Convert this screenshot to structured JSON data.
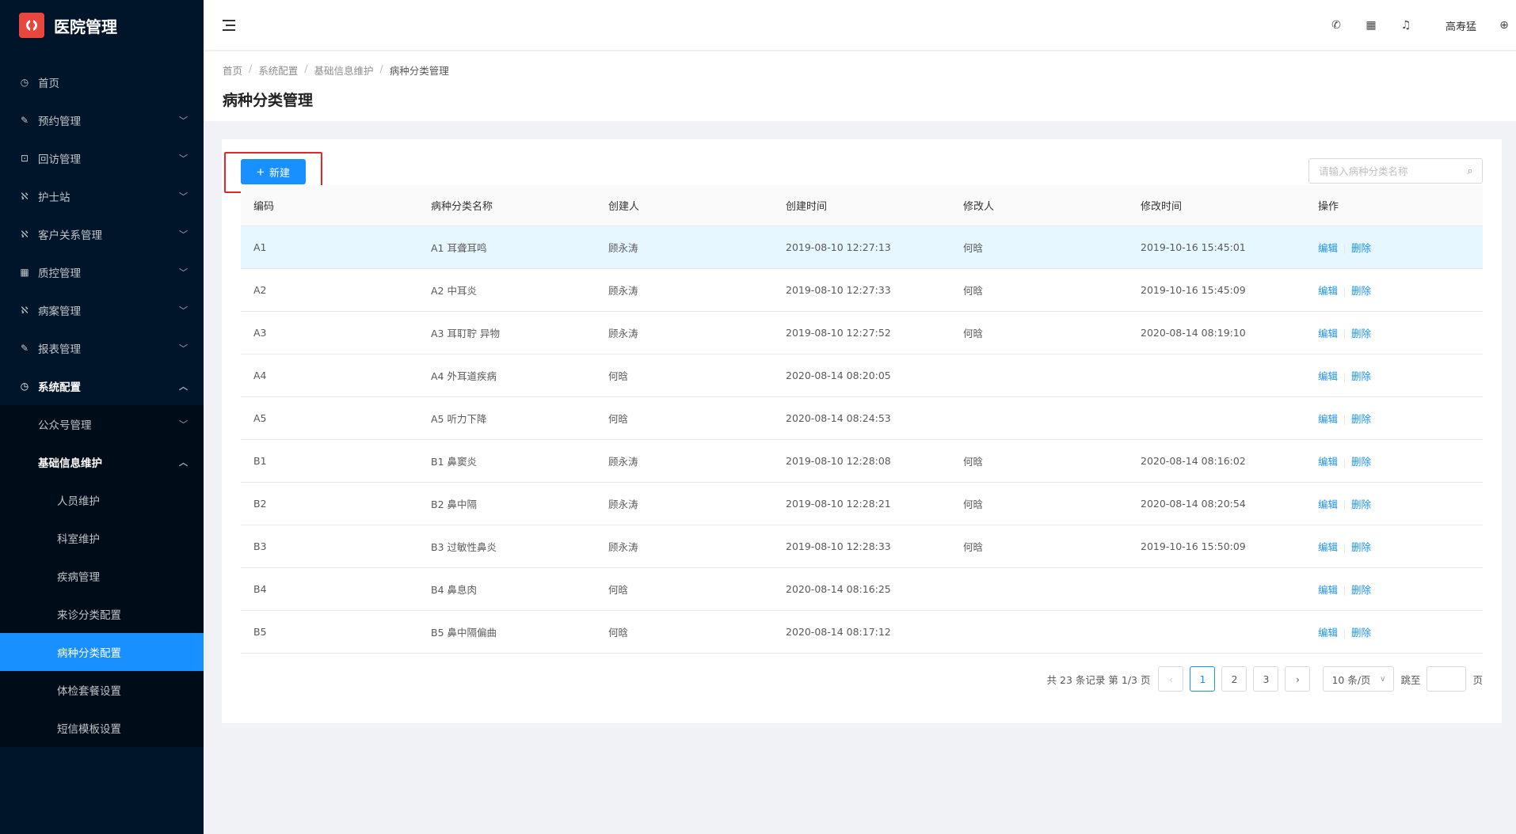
{
  "app": {
    "title": "医院管理"
  },
  "sidebar": {
    "items": [
      {
        "label": "首页",
        "icon": "dashboard-icon",
        "glyph": "◷",
        "has_children": false
      },
      {
        "label": "预约管理",
        "icon": "edit-icon",
        "glyph": "✎",
        "has_children": true
      },
      {
        "label": "回访管理",
        "icon": "lock-icon",
        "glyph": "⊡",
        "has_children": true
      },
      {
        "label": "护士站",
        "icon": "team-icon",
        "glyph": "ℵ",
        "has_children": true
      },
      {
        "label": "客户关系管理",
        "icon": "team-icon",
        "glyph": "ℵ",
        "has_children": true
      },
      {
        "label": "质控管理",
        "icon": "table-icon",
        "glyph": "▦",
        "has_children": true
      },
      {
        "label": "病案管理",
        "icon": "team-icon",
        "glyph": "ℵ",
        "has_children": true
      },
      {
        "label": "报表管理",
        "icon": "edit-icon",
        "glyph": "✎",
        "has_children": true
      },
      {
        "label": "系统配置",
        "icon": "dashboard-icon",
        "glyph": "◷",
        "has_children": true
      }
    ],
    "system_sub": [
      {
        "label": "公众号管理"
      },
      {
        "label": "基础信息维护"
      }
    ],
    "basic_info_sub": [
      {
        "label": "人员维护"
      },
      {
        "label": "科室维护"
      },
      {
        "label": "疾病管理"
      },
      {
        "label": "来诊分类配置"
      },
      {
        "label": "病种分类配置"
      },
      {
        "label": "体检套餐设置"
      },
      {
        "label": "短信模板设置"
      }
    ]
  },
  "header": {
    "user_name": "高寿猛"
  },
  "breadcrumb": [
    "首页",
    "系统配置",
    "基础信息维护",
    "病种分类管理"
  ],
  "page_title": "病种分类管理",
  "toolbar": {
    "new_label": "新建",
    "search_placeholder": "请输入病种分类名称"
  },
  "table": {
    "columns": [
      "编码",
      "病种分类名称",
      "创建人",
      "创建时间",
      "修改人",
      "修改时间",
      "操作"
    ],
    "rows": [
      {
        "code": "A1",
        "name": "A1 耳聋耳鸣",
        "creator": "顾永涛",
        "created": "2019-08-10 12:27:13",
        "modifier": "何晗",
        "modified": "2019-10-16 15:45:01"
      },
      {
        "code": "A2",
        "name": "A2 中耳炎",
        "creator": "顾永涛",
        "created": "2019-08-10 12:27:33",
        "modifier": "何晗",
        "modified": "2019-10-16 15:45:09"
      },
      {
        "code": "A3",
        "name": "A3 耳耵聍 异物",
        "creator": "顾永涛",
        "created": "2019-08-10 12:27:52",
        "modifier": "何晗",
        "modified": "2020-08-14 08:19:10"
      },
      {
        "code": "A4",
        "name": "A4 外耳道疾病",
        "creator": "何晗",
        "created": "2020-08-14 08:20:05",
        "modifier": "",
        "modified": ""
      },
      {
        "code": "A5",
        "name": "A5 听力下降",
        "creator": "何晗",
        "created": "2020-08-14 08:24:53",
        "modifier": "",
        "modified": ""
      },
      {
        "code": "B1",
        "name": "B1 鼻窦炎",
        "creator": "顾永涛",
        "created": "2019-08-10 12:28:08",
        "modifier": "何晗",
        "modified": "2020-08-14 08:16:02"
      },
      {
        "code": "B2",
        "name": "B2 鼻中隔",
        "creator": "顾永涛",
        "created": "2019-08-10 12:28:21",
        "modifier": "何晗",
        "modified": "2020-08-14 08:20:54"
      },
      {
        "code": "B3",
        "name": "B3 过敏性鼻炎",
        "creator": "顾永涛",
        "created": "2019-08-10 12:28:33",
        "modifier": "何晗",
        "modified": "2019-10-16 15:50:09"
      },
      {
        "code": "B4",
        "name": "B4 鼻息肉",
        "creator": "何晗",
        "created": "2020-08-14 08:16:25",
        "modifier": "",
        "modified": ""
      },
      {
        "code": "B5",
        "name": "B5 鼻中隔偏曲",
        "creator": "何晗",
        "created": "2020-08-14 08:17:12",
        "modifier": "",
        "modified": ""
      }
    ],
    "edit_label": "编辑",
    "delete_label": "删除"
  },
  "pagination": {
    "total_text": "共 23 条记录 第 1/3 页",
    "prev": "‹",
    "next": "›",
    "pages": [
      "1",
      "2",
      "3"
    ],
    "page_size": "10 条/页",
    "jump_label": "跳至",
    "page_suffix": "页"
  },
  "colors": {
    "primary": "#1890ff",
    "sidebar_bg": "#001529",
    "highlight": "#e8262a"
  }
}
